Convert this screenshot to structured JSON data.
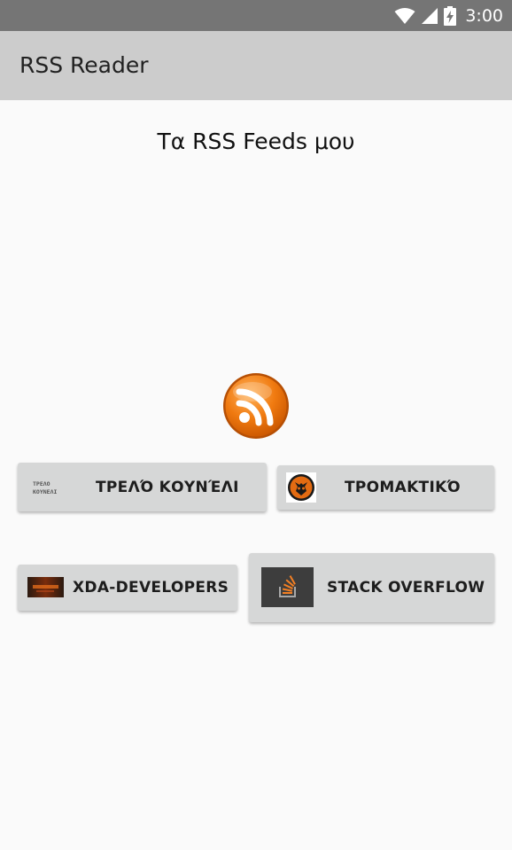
{
  "status_bar": {
    "time": "3:00",
    "icons": [
      "wifi-icon",
      "cell-signal-icon",
      "battery-charging-icon"
    ]
  },
  "app_bar": {
    "title": "RSS Reader"
  },
  "main": {
    "heading": "Τα RSS Feeds μου",
    "logo": "rss-logo-icon",
    "feeds": [
      {
        "label": "ΤΡΕΛΌ ΚΟΥΝΈΛΙ",
        "thumb_text": "ΤΡΕΛΟ ΚΟΥΝΕΛΙ"
      },
      {
        "label": "ΤΡΟΜΑΚΤΙΚΌ"
      },
      {
        "label": "XDA-DEVELOPERS"
      },
      {
        "label": "STACK OVERFLOW"
      }
    ]
  },
  "colors": {
    "status_bar": "#757575",
    "app_bar": "#cccccc",
    "background": "#fafafa",
    "button": "#d6d7d7",
    "rss_orange": "#f07a10"
  }
}
